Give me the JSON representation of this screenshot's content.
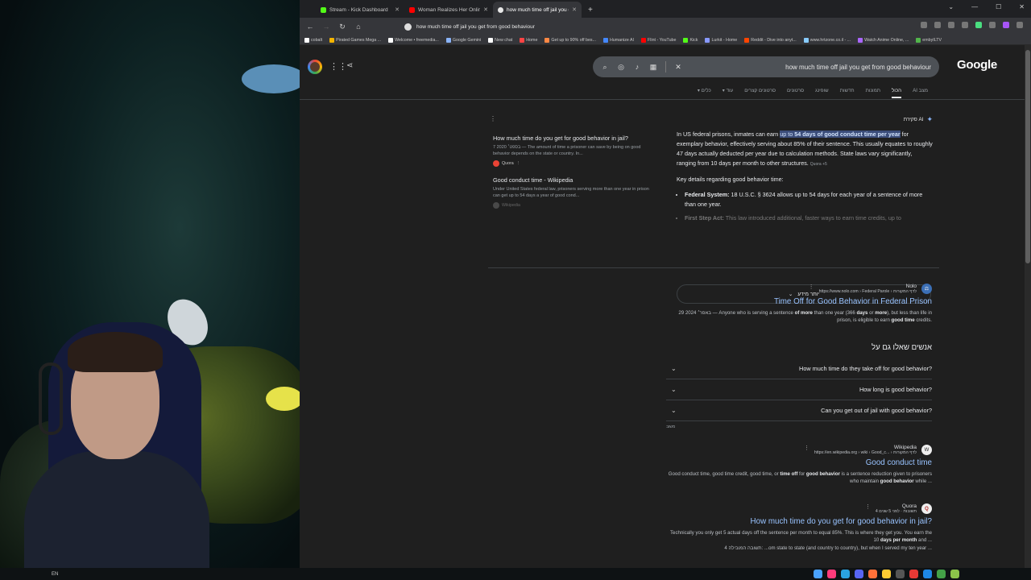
{
  "taskbar": {
    "lang": "EN"
  },
  "browser": {
    "tabs": [
      {
        "title": "Stream - Kick Dashboard",
        "color": "#53fc18"
      },
      {
        "title": "Woman Realizes Her Online Da",
        "color": "#ff0000"
      },
      {
        "title": "how much time off jail you get",
        "color": "#e8e8e8"
      }
    ],
    "address": "how much time off jail you get from good behaviour",
    "bookmarks": [
      {
        "label": "cobalt",
        "color": "#ffffff"
      },
      {
        "label": "Pirated Games Mega ...",
        "color": "#f4b400"
      },
      {
        "label": "Welcome • freemedia...",
        "color": "#ffffff"
      },
      {
        "label": "Google Gemini",
        "color": "#8ab4f8"
      },
      {
        "label": "New chat",
        "color": "#ffffff"
      },
      {
        "label": "Home",
        "color": "#ff4444"
      },
      {
        "label": "Get up to 90% off bes...",
        "color": "#ff8844"
      },
      {
        "label": "Humanize AI",
        "color": "#4488ff"
      },
      {
        "label": "Flint - YouTube",
        "color": "#ff0000"
      },
      {
        "label": "Kick",
        "color": "#53fc18"
      },
      {
        "label": "Lurkit - Home",
        "color": "#8899ff"
      },
      {
        "label": "Reddit - Dive into anyt...",
        "color": "#ff4500"
      },
      {
        "label": "www.hrtzone.co.il - ...",
        "color": "#88ccff"
      },
      {
        "label": "Watch Anime Online, ...",
        "color": "#aa66ff"
      },
      {
        "label": "embyILTV",
        "color": "#52b54b"
      }
    ]
  },
  "google": {
    "query": "how much time off jail you get from good behaviour",
    "logo": "Google",
    "tabs": [
      "מצב AI",
      "הכול",
      "תמונות",
      "חדשות",
      "שופינג",
      "סרטונים",
      "סרטונים קצרים",
      "עוד ▾",
      "כלים ▾"
    ],
    "active_tab": "הכול",
    "ai_overview": {
      "label": "סקירת AI",
      "sources": [
        {
          "title": "How much time do you get for good behavior in jail?",
          "desc": "7 בספט׳ 2020 — The amount of time a prisoner can save by being on good behavior depends on the state or country. In...",
          "site": "Quora"
        },
        {
          "title": "Good conduct time - Wikipedia",
          "desc": "Under United States federal law, prisoners serving more than one year in prison can get up to 54 days a year of good cond...",
          "site": "Wikipedia"
        }
      ],
      "p1_pre": "In US federal prisons, inmates can earn ",
      "p1_hl1": "up to ",
      "p1_hl2": "54 days of good conduct time per year",
      "p1_post": " for exemplary behavior, effectively serving about 85% of their sentence. This usually equates to roughly 47 days actually deducted per year due to calculation methods. State laws vary significantly, ranging from 10 days per month to other structures.",
      "p1_chip": "Quora +5",
      "p2": "Key details regarding good behavior time:",
      "b1_title": "Federal System:",
      "b1_text": " 18 U.S.C. § 3624 allows up to 54 days for each year of a sentence of more than one year.",
      "b2_title": "First Step Act:",
      "b2_text": " This law introduced additional, faster ways to earn time credits, up to",
      "more": "יותר מידע"
    },
    "results": [
      {
        "site": "Nolo",
        "url": "https://www.nolo.com › Federal Parole › לדף המקורות",
        "title": "Time Off for Good Behavior in Federal Prison",
        "snippet_a": "29 באפר׳ 2024 — Anyone who is serving a sentence ",
        "snippet_b1": "of more",
        "snippet_c": " than one year (366 ",
        "snippet_b2": "days",
        "snippet_d": " or ",
        "snippet_b3": "more",
        "snippet_e": "), but less than life in prison, is eligible to earn ",
        "snippet_b4": "good time",
        "snippet_f": " credits.",
        "fav": "⚖"
      },
      {
        "site": "Wikipedia",
        "url": "https://en.wikipedia.org › wiki › Good_c... › לדף המקורות",
        "title": "Good conduct time",
        "snippet_a": "Good conduct time, good time credit, good time, or ",
        "snippet_b1": "time off",
        "snippet_c": " for ",
        "snippet_b2": "good behavior",
        "snippet_d": " is a sentence reduction given to prisoners who maintain ",
        "snippet_b3": "good behavior",
        "snippet_e": " while ...",
        "fav": "W"
      },
      {
        "site": "Quora",
        "url": "4 תשובות · לפני 5 שנים",
        "title": "How much time do you get for good behavior in jail?",
        "snippet_a": "Technically you only get 5 actual days off the sentence per month to equal 85%. This is where they get you. You earn the 10 ",
        "snippet_b1": "days per month",
        "snippet_c": " and ...",
        "snippet_d": "4 תשובה המובילה: ...om state to state (and country to country), but when I served my ten year ...",
        "fav": "Q"
      }
    ],
    "paa": {
      "title": "אנשים שאלו גם על",
      "questions": [
        "How much time do they take off for good behavior?",
        "How long is good behavior?",
        "Can you get out of jail with good behavior?"
      ],
      "feedback": "משוב"
    }
  }
}
